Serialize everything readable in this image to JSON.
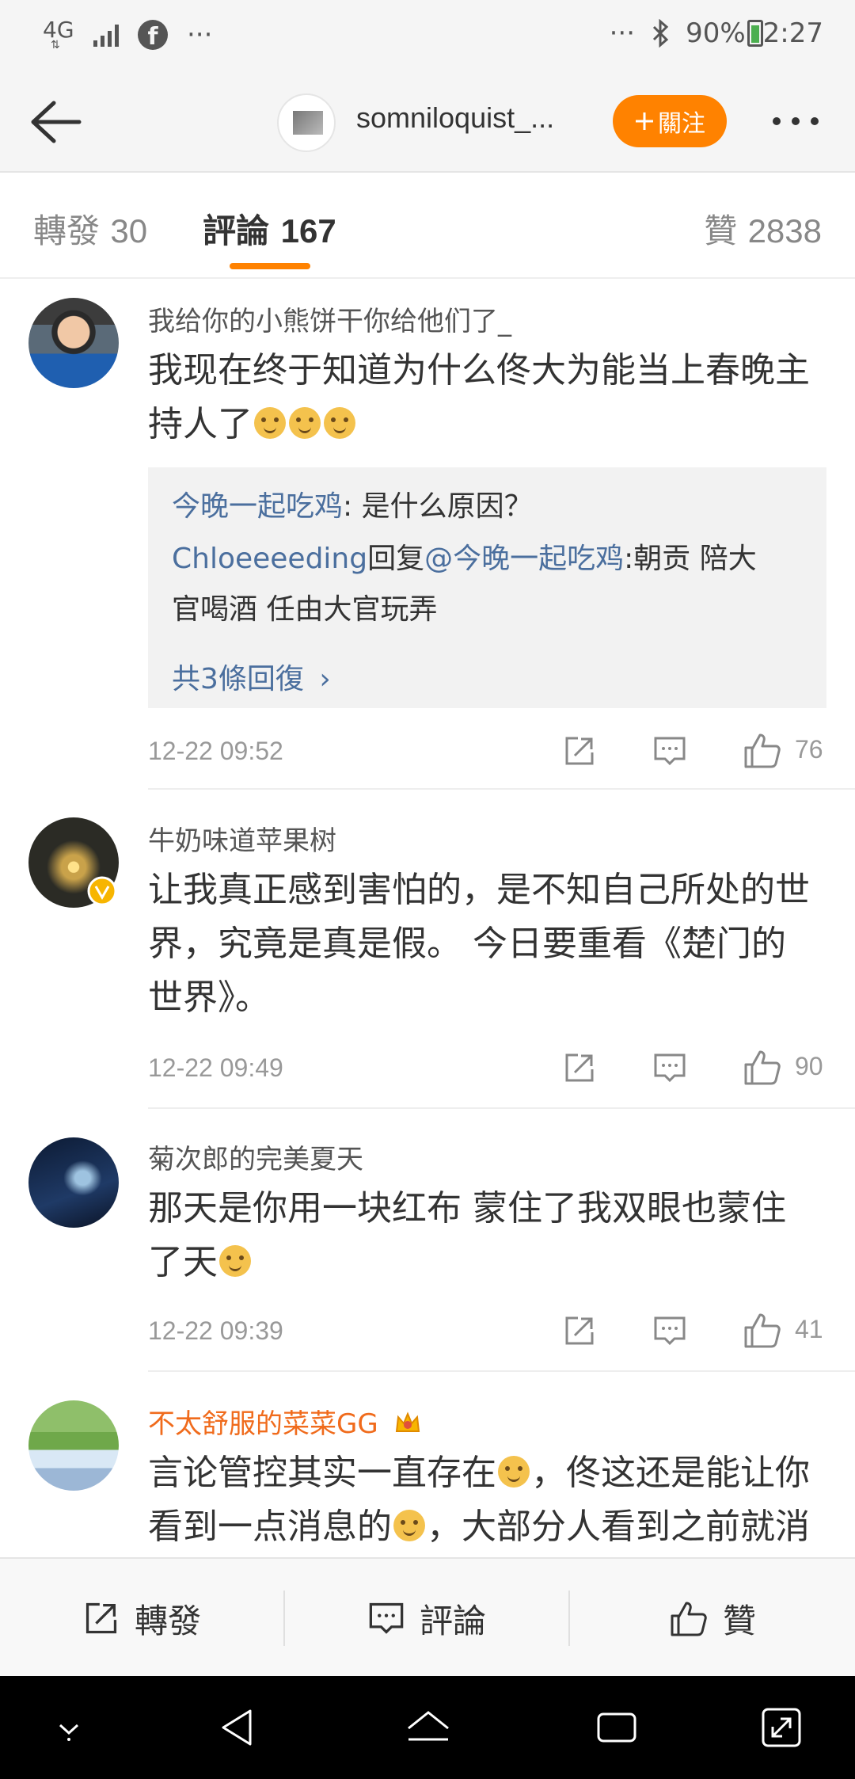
{
  "status_bar": {
    "network": "4G",
    "battery": "90%",
    "time": "2:27"
  },
  "nav": {
    "username": "somniloquist_...",
    "follow_label": "關注"
  },
  "tabs": {
    "repost_label": "轉發",
    "repost_count": "30",
    "comments_label": "評論",
    "comments_count": "167",
    "likes_label": "贊",
    "likes_count": "2838"
  },
  "comments": [
    {
      "name": "我给你的小熊饼干你给他们了_",
      "text_line1": "我现在终于知道为什么佟大为能当上春晚主",
      "text_line2": "持人了",
      "time": "12-22 09:52",
      "likes": "76",
      "replies": [
        {
          "author": "今晚一起吃鸡",
          "text": ": 是什么原因？"
        },
        {
          "author": "Chloeeeeding",
          "mid": "回复",
          "mention": "@今晚一起吃鸡",
          "text_a": ":朝贡 陪大",
          "text_b": "官喝酒 任由大官玩弄"
        }
      ],
      "more_replies": "共3條回復"
    },
    {
      "name": "牛奶味道苹果树",
      "text_line1": "让我真正感到害怕的，是不知自己所处的世",
      "text_line2": "界，究竟是真是假。 今日要重看《楚门的",
      "text_line3": "世界》。",
      "time": "12-22 09:49",
      "likes": "90"
    },
    {
      "name": "菊次郎的完美夏天",
      "text_line1": "那天是你用一块红布 蒙住了我双眼也蒙住",
      "text_line2": "了天",
      "time": "12-22 09:39",
      "likes": "41"
    },
    {
      "name": "不太舒服的菜菜GG",
      "text_line1a": "言论管控其实一直存在",
      "text_line1b": "，佟这还是能让你",
      "text_line2a": "看到一点消息的",
      "text_line2b": "，大部分人看到之前就消"
    }
  ],
  "bottom_bar": {
    "repost": "轉發",
    "comment": "評論",
    "like": "贊"
  },
  "colors": {
    "accent": "#ff8200",
    "link": "#4b6f9e",
    "vip_name": "#f06b1c"
  }
}
